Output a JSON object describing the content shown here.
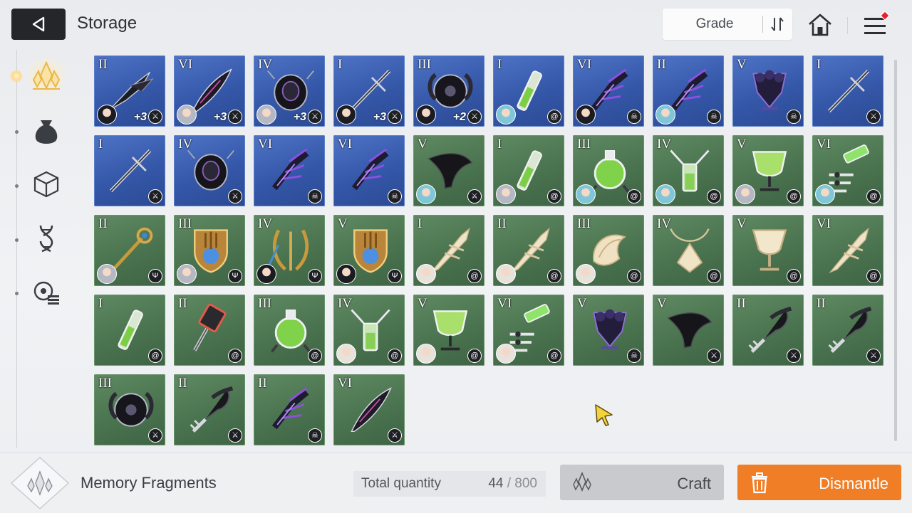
{
  "header": {
    "title": "Storage",
    "sort_label": "Grade",
    "notification_color": "#e8202e"
  },
  "sidebar": {
    "tabs": [
      {
        "name": "sidebar-tab-memory-fragments",
        "icon": "crystal-icon",
        "active": true
      },
      {
        "name": "sidebar-tab-materials",
        "icon": "pouch-icon",
        "active": false
      },
      {
        "name": "sidebar-tab-items",
        "icon": "cube-icon",
        "active": false
      },
      {
        "name": "sidebar-tab-genes",
        "icon": "dna-icon",
        "active": false
      },
      {
        "name": "sidebar-tab-misc",
        "icon": "list-icon",
        "active": false
      }
    ]
  },
  "items": [
    {
      "roman": "II",
      "bg": "blue",
      "art": "claw",
      "avatar": "black",
      "plus": "+3",
      "cls": "sword"
    },
    {
      "roman": "VI",
      "bg": "blue",
      "art": "feather",
      "avatar": "silver",
      "plus": "+3",
      "cls": "sword"
    },
    {
      "roman": "IV",
      "bg": "blue",
      "art": "chain",
      "avatar": "silver",
      "plus": "+3",
      "cls": "sword"
    },
    {
      "roman": "I",
      "bg": "blue",
      "art": "cross",
      "avatar": "black",
      "plus": "+3",
      "cls": "sword"
    },
    {
      "roman": "III",
      "bg": "blue",
      "art": "orb",
      "avatar": "black",
      "plus": "+2",
      "cls": "sword"
    },
    {
      "roman": "I",
      "bg": "blue",
      "art": "vial",
      "avatar": "cyan",
      "plus": "",
      "cls": "swirl"
    },
    {
      "roman": "VI",
      "bg": "blue",
      "art": "talon",
      "avatar": "black",
      "plus": "",
      "cls": "skull"
    },
    {
      "roman": "II",
      "bg": "blue",
      "art": "talon",
      "avatar": "cyan",
      "plus": "",
      "cls": "skull"
    },
    {
      "roman": "V",
      "bg": "blue",
      "art": "dark",
      "avatar": "",
      "plus": "",
      "cls": "skull"
    },
    {
      "roman": "I",
      "bg": "blue",
      "art": "cross",
      "avatar": "",
      "plus": "",
      "cls": "sword"
    },
    {
      "roman": "I",
      "bg": "blue",
      "art": "cross",
      "avatar": "",
      "plus": "",
      "cls": "sword"
    },
    {
      "roman": "IV",
      "bg": "blue",
      "art": "chain",
      "avatar": "",
      "plus": "",
      "cls": "sword"
    },
    {
      "roman": "VI",
      "bg": "blue",
      "art": "talon",
      "avatar": "",
      "plus": "",
      "cls": "skull"
    },
    {
      "roman": "VI",
      "bg": "blue",
      "art": "talon",
      "avatar": "",
      "plus": "",
      "cls": "skull"
    },
    {
      "roman": "V",
      "bg": "green",
      "art": "bird",
      "avatar": "cyan",
      "plus": "",
      "cls": "sword"
    },
    {
      "roman": "I",
      "bg": "green",
      "art": "vial",
      "avatar": "silver",
      "plus": "",
      "cls": "swirl"
    },
    {
      "roman": "III",
      "bg": "green",
      "art": "flask",
      "avatar": "cyan",
      "plus": "",
      "cls": "swirl"
    },
    {
      "roman": "IV",
      "bg": "green",
      "art": "tube",
      "avatar": "cyan",
      "plus": "",
      "cls": "swirl"
    },
    {
      "roman": "V",
      "bg": "green",
      "art": "goblet",
      "avatar": "silver",
      "plus": "",
      "cls": "swirl"
    },
    {
      "roman": "VI",
      "bg": "green",
      "art": "syringe",
      "avatar": "cyan",
      "plus": "",
      "cls": "swirl"
    },
    {
      "roman": "II",
      "bg": "green",
      "art": "staff",
      "avatar": "silver",
      "plus": "",
      "cls": "trident"
    },
    {
      "roman": "III",
      "bg": "green",
      "art": "crest",
      "avatar": "silver",
      "plus": "",
      "cls": "trident"
    },
    {
      "roman": "IV",
      "bg": "green",
      "art": "gold",
      "avatar": "black",
      "plus": "",
      "cls": "trident"
    },
    {
      "roman": "V",
      "bg": "green",
      "art": "crest",
      "avatar": "black",
      "plus": "",
      "cls": "trident"
    },
    {
      "roman": "I",
      "bg": "green",
      "art": "pale",
      "avatar": "white",
      "plus": "",
      "cls": "swirl"
    },
    {
      "roman": "II",
      "bg": "green",
      "art": "pale",
      "avatar": "white",
      "plus": "",
      "cls": "swirl"
    },
    {
      "roman": "III",
      "bg": "green",
      "art": "shell",
      "avatar": "white",
      "plus": "",
      "cls": "swirl"
    },
    {
      "roman": "IV",
      "bg": "green",
      "art": "pendant",
      "avatar": "",
      "plus": "",
      "cls": "swirl"
    },
    {
      "roman": "V",
      "bg": "green",
      "art": "palegoblet",
      "avatar": "",
      "plus": "",
      "cls": "swirl"
    },
    {
      "roman": "VI",
      "bg": "green",
      "art": "pale",
      "avatar": "",
      "plus": "",
      "cls": "swirl"
    },
    {
      "roman": "I",
      "bg": "green",
      "art": "vial",
      "avatar": "",
      "plus": "",
      "cls": "swirl"
    },
    {
      "roman": "II",
      "bg": "green",
      "art": "roller",
      "avatar": "",
      "plus": "",
      "cls": "swirl"
    },
    {
      "roman": "III",
      "bg": "green",
      "art": "flask",
      "avatar": "",
      "plus": "",
      "cls": "swirl"
    },
    {
      "roman": "IV",
      "bg": "green",
      "art": "tube",
      "avatar": "white",
      "plus": "",
      "cls": "swirl"
    },
    {
      "roman": "V",
      "bg": "green",
      "art": "goblet",
      "avatar": "white",
      "plus": "",
      "cls": "swirl"
    },
    {
      "roman": "VI",
      "bg": "green",
      "art": "syringe",
      "avatar": "white",
      "plus": "",
      "cls": "swirl"
    },
    {
      "roman": "V",
      "bg": "green",
      "art": "dark",
      "avatar": "",
      "plus": "",
      "cls": "skull"
    },
    {
      "roman": "V",
      "bg": "green",
      "art": "bird",
      "avatar": "",
      "plus": "",
      "cls": "sword"
    },
    {
      "roman": "II",
      "bg": "green",
      "art": "key",
      "avatar": "",
      "plus": "",
      "cls": "sword"
    },
    {
      "roman": "II",
      "bg": "green",
      "art": "key",
      "avatar": "",
      "plus": "",
      "cls": "sword"
    },
    {
      "roman": "III",
      "bg": "green",
      "art": "orb",
      "avatar": "",
      "plus": "",
      "cls": "sword"
    },
    {
      "roman": "II",
      "bg": "green",
      "art": "key",
      "avatar": "",
      "plus": "",
      "cls": "sword"
    },
    {
      "roman": "II",
      "bg": "green",
      "art": "talon",
      "avatar": "",
      "plus": "",
      "cls": "skull"
    },
    {
      "roman": "VI",
      "bg": "green",
      "art": "feather",
      "avatar": "",
      "plus": "",
      "cls": "sword"
    }
  ],
  "footer": {
    "category_label": "Memory Fragments",
    "quantity_label": "Total quantity",
    "quantity_current": "44",
    "quantity_separator": "/",
    "quantity_max": "800",
    "craft_label": "Craft",
    "dismantle_label": "Dismantle",
    "dismantle_color": "#ef7e27"
  }
}
